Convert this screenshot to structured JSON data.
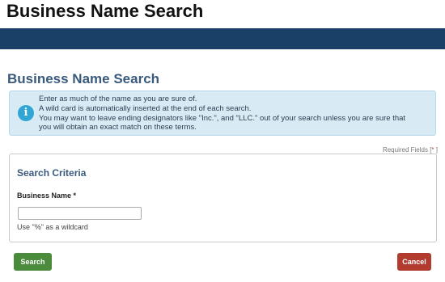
{
  "header": {
    "site_title": "Business Name Search"
  },
  "page": {
    "heading": "Business Name Search"
  },
  "info": {
    "icon": "info-icon",
    "icon_glyph": "i",
    "lines": [
      "Enter as much of the name as you are sure of.",
      "A wild card is automatically inserted at the end of each search.",
      "You may want to leave ending designators like \"Inc.\", and \"LLC.\" out of your search unless you are sure that",
      "you will obtain an exact match on these terms."
    ]
  },
  "required_note": {
    "text": "Required Fields [",
    "star": "*",
    "close": " ]"
  },
  "criteria": {
    "title": "Search Criteria",
    "business_name_label": "Business Name",
    "required_marker": " *",
    "business_name_value": "",
    "help_text": "Use \"%\" as a wildcard"
  },
  "actions": {
    "search_label": "Search",
    "cancel_label": "Cancel"
  },
  "colors": {
    "navbar": "#1b4067",
    "heading": "#3a5a7c",
    "info_bg": "#d8ebf4",
    "search_btn": "#4a8b3c",
    "cancel_btn": "#b23b2f"
  }
}
